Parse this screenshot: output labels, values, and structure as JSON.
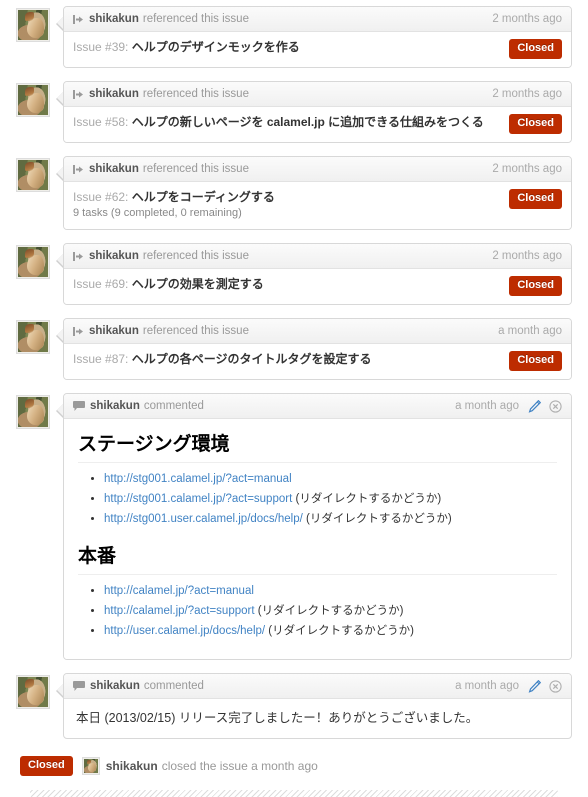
{
  "actor": "shikakun",
  "labels": {
    "referenced_verb": "referenced this issue",
    "commented_verb": "commented",
    "closed_badge": "Closed",
    "issue_prefix": "Issue",
    "closed_event_text": "closed the issue a month ago"
  },
  "colors": {
    "closed_badge_bg": "#bd2c00",
    "link": "#4183c4",
    "edit_icon": "#4183c4",
    "muted_text": "#999999",
    "box_border": "#d8d8d8"
  },
  "events": [
    {
      "type": "referenced",
      "icon": "cross-reference-icon",
      "actor": "shikakun",
      "verb": "referenced this issue",
      "when": "2 months ago",
      "issue_num": "Issue #39:",
      "issue_title": "ヘルプのデザインモックを作る",
      "task_meta": "",
      "state": "Closed"
    },
    {
      "type": "referenced",
      "icon": "cross-reference-icon",
      "actor": "shikakun",
      "verb": "referenced this issue",
      "when": "2 months ago",
      "issue_num": "Issue #58:",
      "issue_title": "ヘルプの新しいページを calamel.jp に追加できる仕組みをつくる",
      "task_meta": "",
      "state": "Closed"
    },
    {
      "type": "referenced",
      "icon": "cross-reference-icon",
      "actor": "shikakun",
      "verb": "referenced this issue",
      "when": "2 months ago",
      "issue_num": "Issue #62:",
      "issue_title": "ヘルプをコーディングする",
      "task_meta": "9 tasks (9 completed, 0 remaining)",
      "state": "Closed"
    },
    {
      "type": "referenced",
      "icon": "cross-reference-icon",
      "actor": "shikakun",
      "verb": "referenced this issue",
      "when": "2 months ago",
      "issue_num": "Issue #69:",
      "issue_title": "ヘルプの効果を測定する",
      "task_meta": "",
      "state": "Closed"
    },
    {
      "type": "referenced",
      "icon": "cross-reference-icon",
      "actor": "shikakun",
      "verb": "referenced this issue",
      "when": "a month ago",
      "issue_num": "Issue #87:",
      "issue_title": "ヘルプの各ページのタイトルタグを設定する",
      "task_meta": "",
      "state": "Closed"
    }
  ],
  "comment_rich": {
    "icon": "comment-icon",
    "actor": "shikakun",
    "verb": "commented",
    "when": "a month ago",
    "edit_icon": "pencil-icon",
    "delete_icon": "circle-x-icon",
    "sections": [
      {
        "heading": "ステージング環境",
        "links": [
          {
            "url": "http://stg001.calamel.jp/?act=manual",
            "note": ""
          },
          {
            "url": "http://stg001.calamel.jp/?act=support",
            "note": "(リダイレクトするかどうか)"
          },
          {
            "url": "http://stg001.user.calamel.jp/docs/help/",
            "note": "(リダイレクトするかどうか)"
          }
        ]
      },
      {
        "heading": "本番",
        "links": [
          {
            "url": "http://calamel.jp/?act=manual",
            "note": ""
          },
          {
            "url": "http://calamel.jp/?act=support",
            "note": "(リダイレクトするかどうか)"
          },
          {
            "url": "http://user.calamel.jp/docs/help/",
            "note": "(リダイレクトするかどうか)"
          }
        ]
      }
    ]
  },
  "comment_plain": {
    "icon": "comment-icon",
    "actor": "shikakun",
    "verb": "commented",
    "when": "a month ago",
    "edit_icon": "pencil-icon",
    "delete_icon": "circle-x-icon",
    "body": "本日 (2013/02/15) リリース完了しましたー！ありがとうございました。"
  },
  "closed_event": {
    "badge": "Closed",
    "actor": "shikakun",
    "text": "closed the issue a month ago"
  }
}
